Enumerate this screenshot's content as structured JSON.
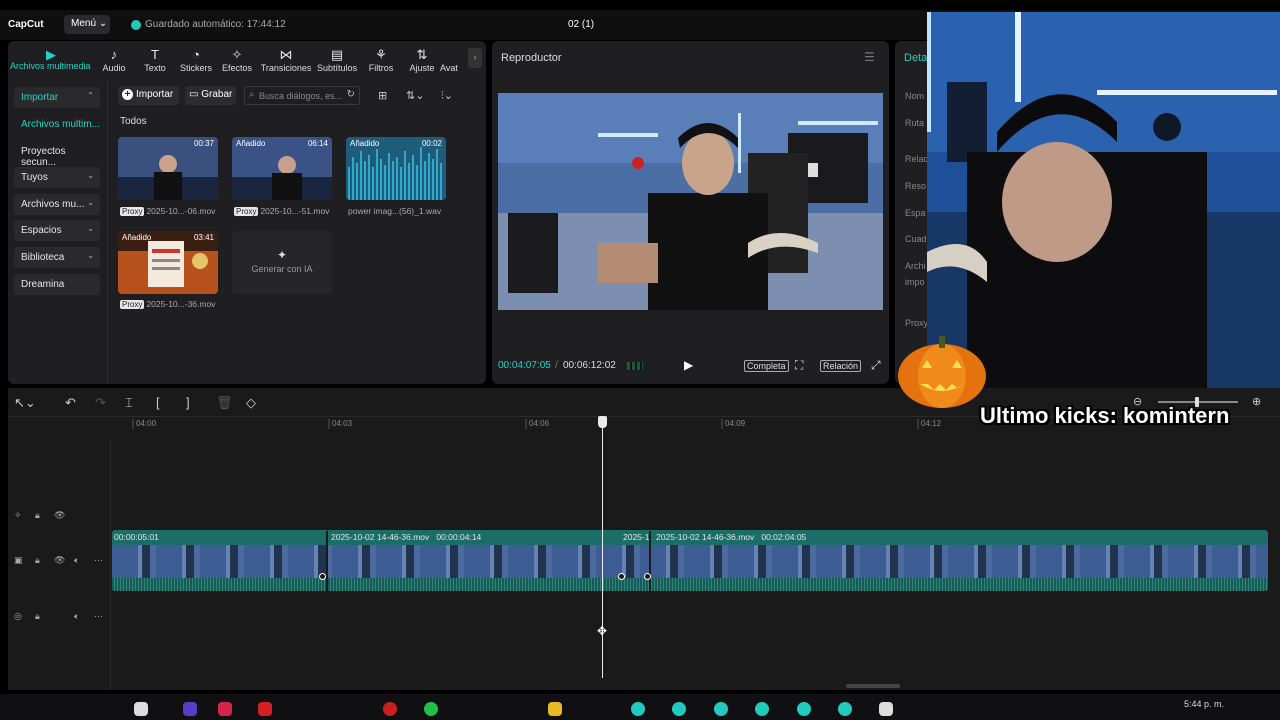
{
  "app": {
    "logo": "CapCut",
    "menu_label": "Menú",
    "autosave": "Guardado automático: 17:44:12",
    "project_title": "02 (1)"
  },
  "toolbar_tabs": [
    {
      "label": "Archivos multimedia",
      "icon": "media-icon",
      "active": true
    },
    {
      "label": "Audio",
      "icon": "audio-icon"
    },
    {
      "label": "Texto",
      "icon": "text-icon"
    },
    {
      "label": "Stickers",
      "icon": "sticker-icon"
    },
    {
      "label": "Efectos",
      "icon": "effects-icon"
    },
    {
      "label": "Transiciones",
      "icon": "transitions-icon"
    },
    {
      "label": "Subtítulos",
      "icon": "subtitles-icon"
    },
    {
      "label": "Filtros",
      "icon": "filters-icon"
    },
    {
      "label": "Ajuste",
      "icon": "adjust-icon"
    },
    {
      "label": "Avat",
      "icon": "avatar-icon"
    }
  ],
  "sidebar": {
    "items": [
      {
        "label": "Importar",
        "chevron": "^"
      },
      {
        "label": "Archivos multim..."
      },
      {
        "label": "Proyectos secun..."
      },
      {
        "label": "Tuyos",
        "chevron": "v"
      },
      {
        "label": "Archivos mu...",
        "chevron": "v"
      },
      {
        "label": "Espacios",
        "chevron": "v"
      },
      {
        "label": "Biblioteca",
        "chevron": "v"
      },
      {
        "label": "Dreamina"
      }
    ]
  },
  "media": {
    "import_btn": "Importar",
    "record_btn": "Grabar",
    "search_placeholder": "Busca diálogos, es...",
    "section_label": "Todos",
    "items": [
      {
        "duration": "00:37",
        "tag": "",
        "proxy": "Proxy",
        "name": "2025-10...-06.mov"
      },
      {
        "duration": "06:14",
        "tag": "Añadido",
        "proxy": "Proxy",
        "name": "2025-10...-51.mov"
      },
      {
        "duration": "00:02",
        "tag": "Añadido",
        "proxy": "",
        "name": "power imag...(56)_1.wav"
      },
      {
        "duration": "03:41",
        "tag": "Añadido",
        "proxy": "Proxy",
        "name": "2025-10...-36.mov"
      }
    ],
    "generate_ai": "Generar con IA"
  },
  "player": {
    "title": "Reproductor",
    "current_time": "00:04:07:05",
    "separator": "/",
    "total_time": "00:06:12:02",
    "full_label": "Completa",
    "ratio_label": "Relación"
  },
  "details": {
    "title": "Deta",
    "labels": [
      "Nom",
      "Ruta",
      "Relac",
      "Reso",
      "Espa",
      "Cuad",
      "Archi",
      "impo",
      "Proxy"
    ]
  },
  "timeline": {
    "ruler_ticks": [
      "04:00",
      "04:03",
      "04:06",
      "04:09",
      "04:12"
    ],
    "clip_labels": [
      {
        "text": "00:00:05:01"
      },
      {
        "text": "2025-10-02 14-46-36.mov   00:00:04:14"
      },
      {
        "text": "2025-1"
      },
      {
        "text": "2025-10-02 14-46-36.mov   00:02:04:05"
      }
    ]
  },
  "stream_overlay": {
    "text": "Ultimo kicks: komintern"
  },
  "taskbar": {
    "clock": "5:44 p. m."
  },
  "colors": {
    "accent": "#22d3c5",
    "clip": "#1b6d68",
    "panel": "#1f1f21"
  }
}
